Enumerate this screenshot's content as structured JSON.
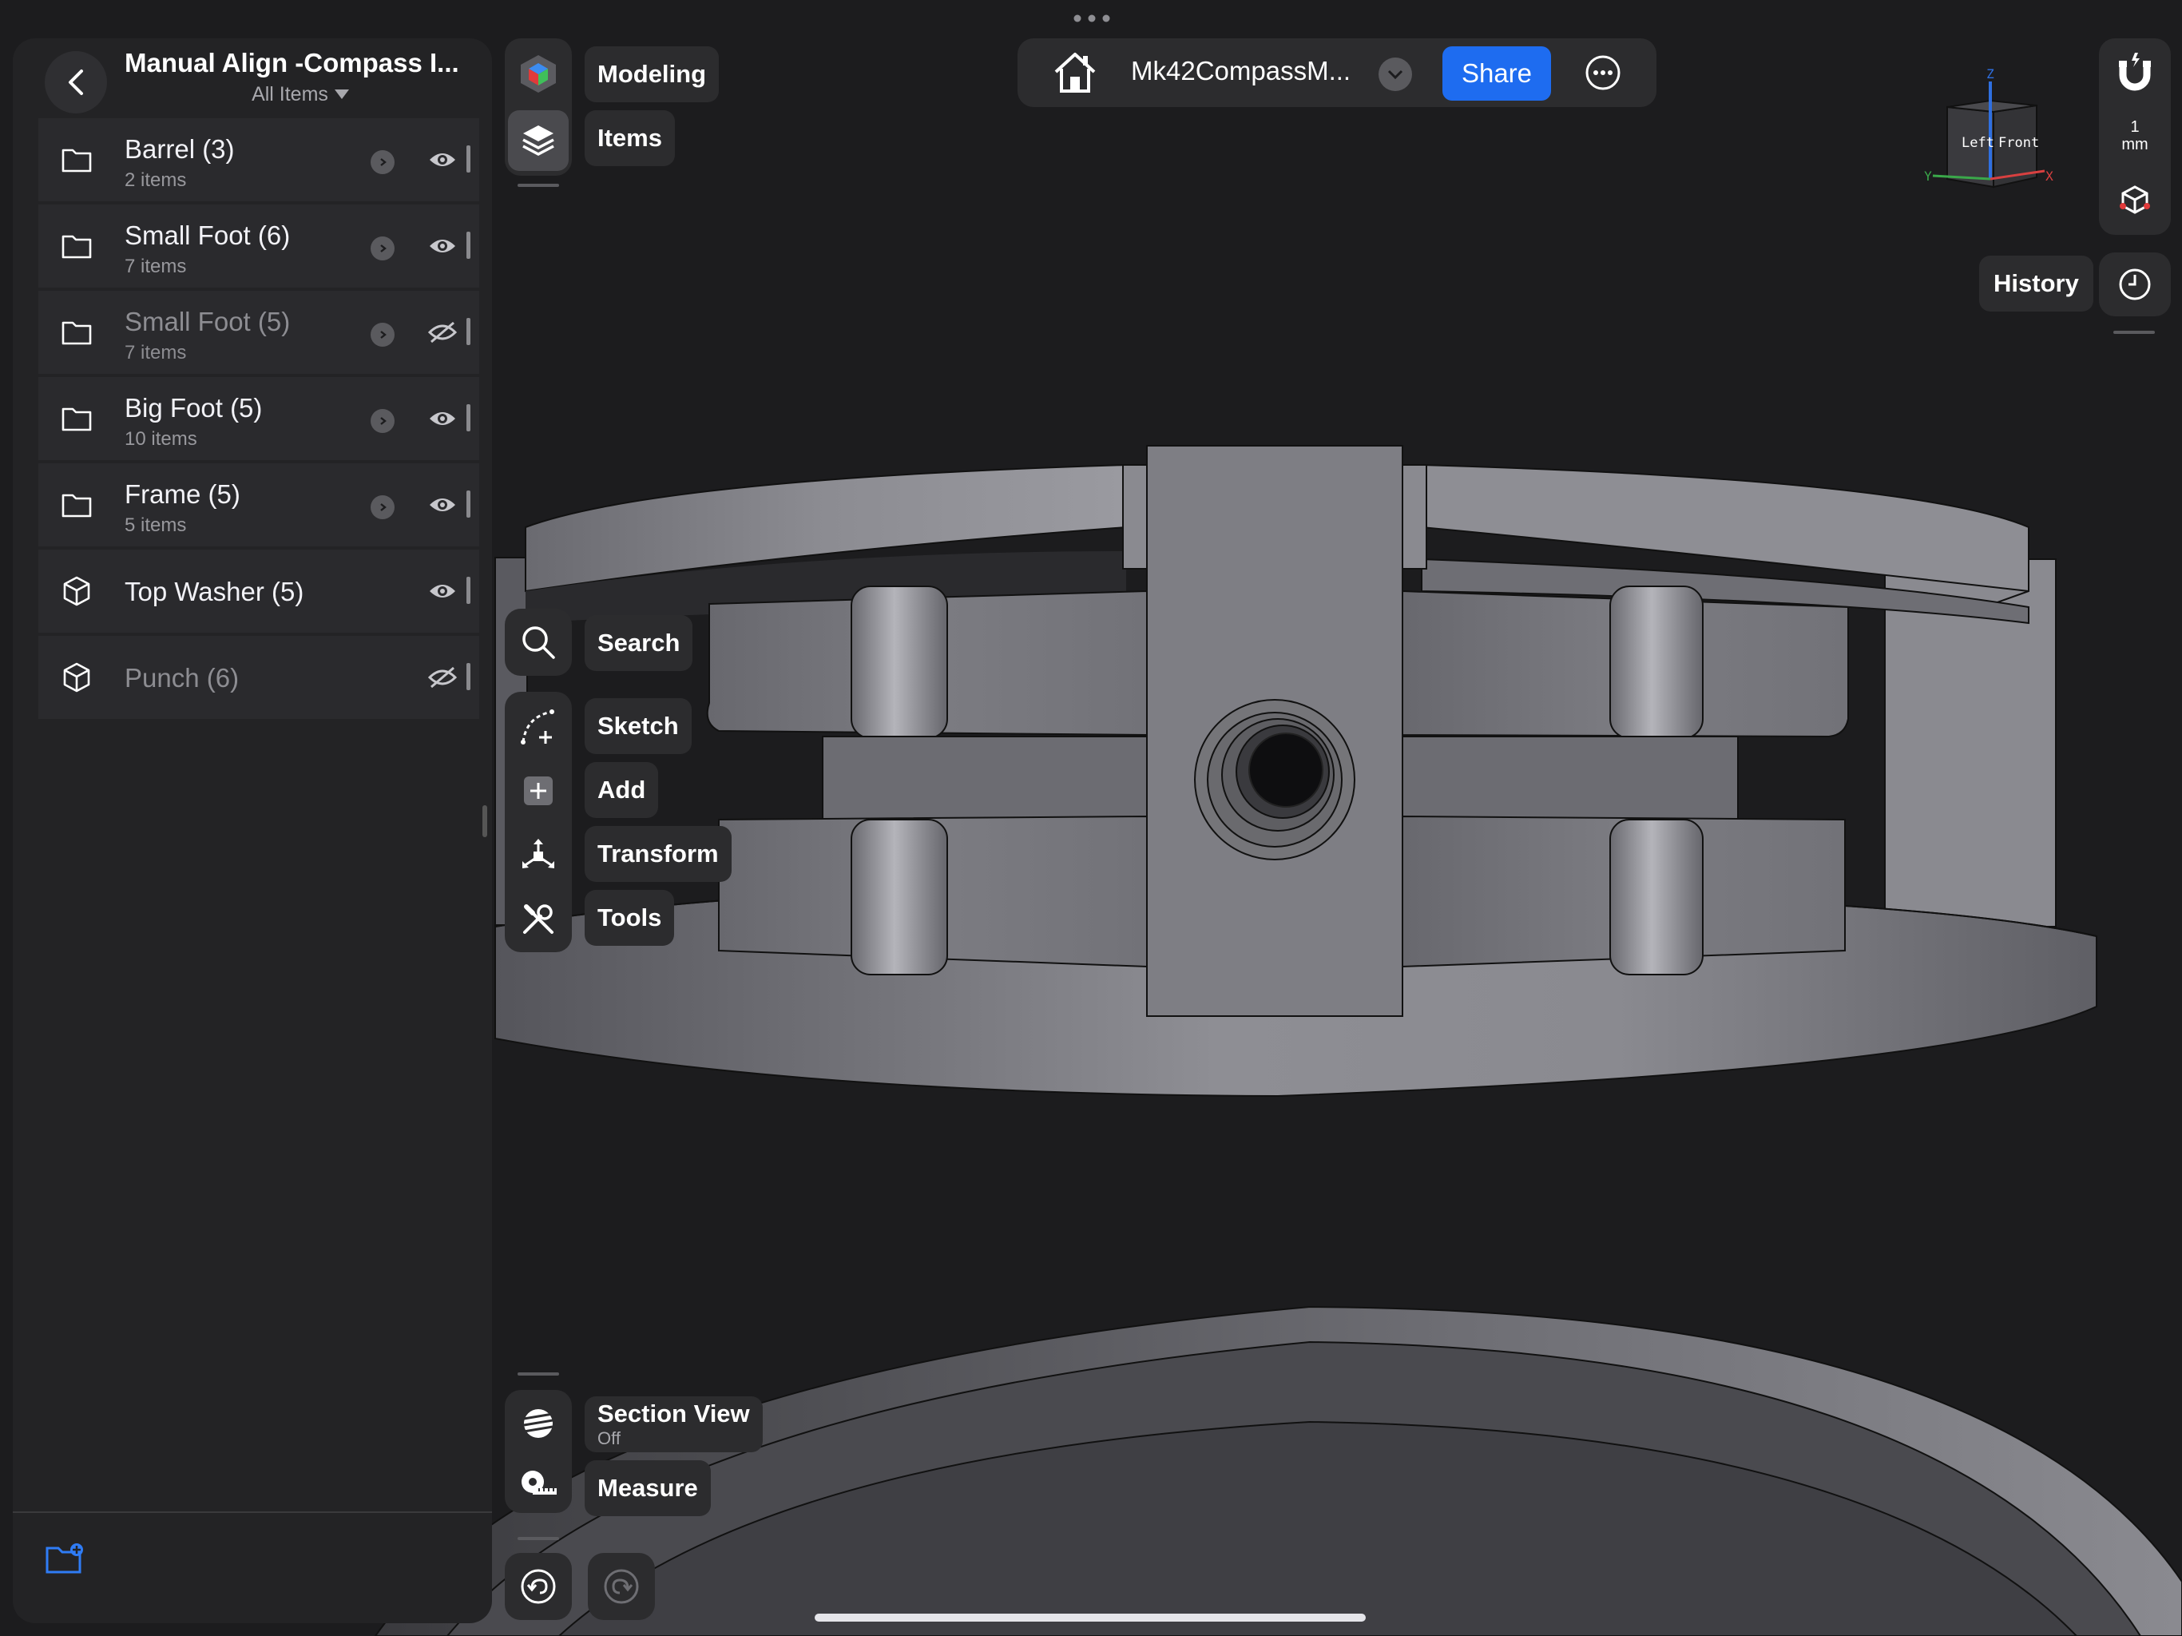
{
  "sidebar": {
    "title": "Manual Align -Compass I...",
    "filter_label": "All Items",
    "items": [
      {
        "name": "Barrel (3)",
        "subtitle": "2 items",
        "kind": "folder-icon",
        "visible": true,
        "expandable": true
      },
      {
        "name": "Small Foot (6)",
        "subtitle": "7 items",
        "kind": "folder-icon",
        "visible": true,
        "expandable": true
      },
      {
        "name": "Small Foot (5)",
        "subtitle": "7 items",
        "kind": "folder-icon",
        "visible": false,
        "expandable": true
      },
      {
        "name": "Big Foot (5)",
        "subtitle": "10 items",
        "kind": "folder-icon",
        "visible": true,
        "expandable": true
      },
      {
        "name": "Frame (5)",
        "subtitle": "5 items",
        "kind": "folder-icon",
        "visible": true,
        "expandable": true
      },
      {
        "name": "Top Washer (5)",
        "subtitle": "",
        "kind": "cube-icon",
        "visible": true,
        "expandable": false
      },
      {
        "name": "Punch (6)",
        "subtitle": "",
        "kind": "cube-icon",
        "visible": false,
        "expandable": false
      }
    ]
  },
  "toolbar": {
    "modeling": "Modeling",
    "items": "Items",
    "search": "Search",
    "sketch": "Sketch",
    "add": "Add",
    "transform": "Transform",
    "tools": "Tools",
    "section_view": "Section View",
    "section_view_state": "Off",
    "measure": "Measure"
  },
  "topbar": {
    "document_title": "Mk42CompassM...",
    "share_label": "Share"
  },
  "view_cube": {
    "left_face": "Left",
    "front_face": "Front",
    "axis_z": "Z",
    "axis_y": "Y",
    "axis_x": "X"
  },
  "right_panel": {
    "unit_value": "1",
    "unit_name": "mm",
    "history_label": "History"
  },
  "colors": {
    "accent": "#1e6cf0",
    "panel": "#2c2c2e",
    "background": "#1c1c1e",
    "model": "#7a7a80"
  }
}
